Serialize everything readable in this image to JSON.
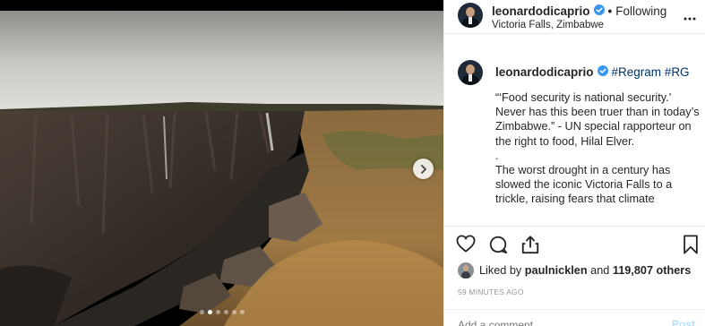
{
  "post": {
    "username": "leonardodicaprio",
    "follow_separator": "•",
    "follow_status": "Following",
    "location": "Victoria Falls, Zimbabwe",
    "more_icon": "more-horizontal-icon"
  },
  "caption": {
    "username": "leonardodicaprio",
    "hashtags": "#Regram #RG",
    "lines": [
      "“‘Food security is national security.’ Never has this been truer than in today’s Zimbabwe.” - UN special rapporteur on the right to food, Hilal Elver.",
      ".",
      "The worst drought in a century has slowed the iconic Victoria Falls to a trickle, raising fears that climate"
    ]
  },
  "actions": {
    "icons": [
      "heart-icon",
      "comment-icon",
      "share-icon",
      "bookmark-icon"
    ]
  },
  "likes": {
    "prefix": "Liked by",
    "user": "paulnicklen",
    "connector": "and",
    "count": "119,807 others"
  },
  "timestamp": "59 MINUTES AGO",
  "comment": {
    "placeholder": "Add a comment...",
    "post_label": "Post"
  },
  "carousel": {
    "total_slides": 6,
    "active_index": 1
  },
  "colors": {
    "verified": "#3897f0",
    "hashtag": "#003569",
    "timestamp": "#999999"
  }
}
